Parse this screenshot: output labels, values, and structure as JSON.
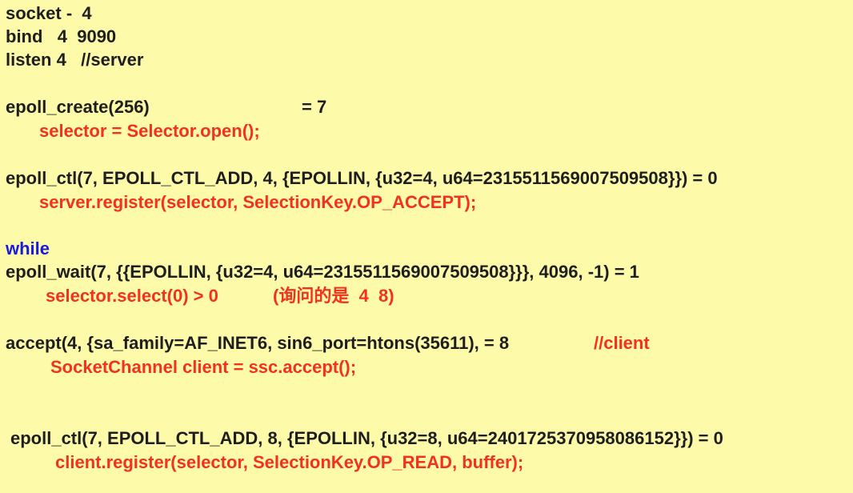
{
  "lines": {
    "socket": "socket -  4",
    "bind": "bind   4  9090",
    "listen": "listen 4   //server",
    "epoll_create": "epoll_create(256)",
    "epoll_create_result": "= 7",
    "selector_open": "selector = Selector.open();",
    "epoll_ctl_server": "epoll_ctl(7, EPOLL_CTL_ADD, 4, {EPOLLIN, {u32=4, u64=2315511569007509508}}) = 0",
    "server_register": "server.register(selector, SelectionKey.OP_ACCEPT);",
    "while_keyword": "while",
    "epoll_wait": "epoll_wait(7, {{EPOLLIN, {u32=4, u64=2315511569007509508}}}, 4096, -1) = 1",
    "selector_select": "selector.select(0) > 0",
    "selector_select_note": "(询问的是  4  8)",
    "accept": "accept(4, {sa_family=AF_INET6, sin6_port=htons(35611), = 8",
    "accept_comment": "//client",
    "ssc_accept": "SocketChannel client = ssc.accept();",
    "epoll_ctl_client": "epoll_ctl(7, EPOLL_CTL_ADD, 8, {EPOLLIN, {u32=8, u64=2401725370958086152}}) = 0",
    "client_register": "client.register(selector, SelectionKey.OP_READ, buffer);"
  },
  "colors": {
    "background": "#fdfbaa",
    "syscall_text": "#1e1e1e",
    "java_text": "#f2321e",
    "keyword": "#1a1adc"
  }
}
